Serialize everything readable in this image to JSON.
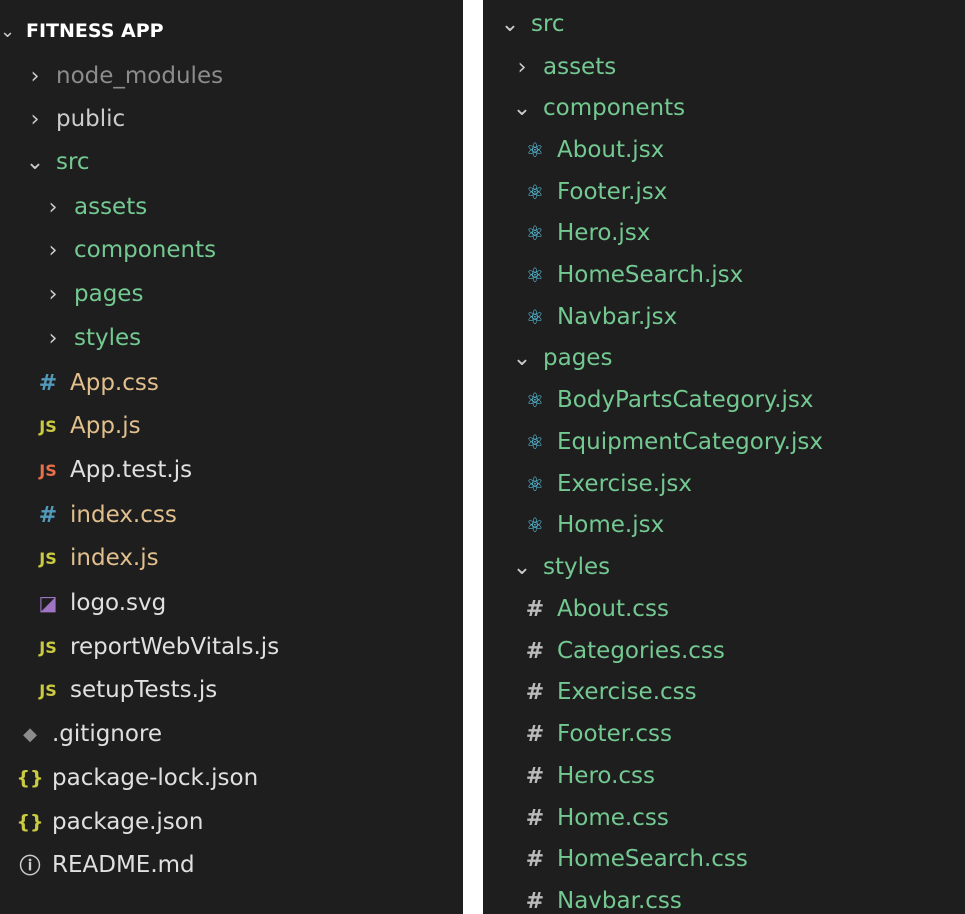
{
  "left": {
    "header": "FITNESS APP",
    "items": [
      {
        "label": "node_modules"
      },
      {
        "label": "public"
      },
      {
        "label": "src"
      },
      {
        "label": "assets"
      },
      {
        "label": "components"
      },
      {
        "label": "pages"
      },
      {
        "label": "styles"
      },
      {
        "label": "App.css"
      },
      {
        "label": "App.js"
      },
      {
        "label": "App.test.js"
      },
      {
        "label": "index.css"
      },
      {
        "label": "index.js"
      },
      {
        "label": "logo.svg"
      },
      {
        "label": "reportWebVitals.js"
      },
      {
        "label": "setupTests.js"
      },
      {
        "label": ".gitignore"
      },
      {
        "label": "package-lock.json"
      },
      {
        "label": "package.json"
      },
      {
        "label": "README.md"
      }
    ]
  },
  "right": {
    "items": [
      {
        "label": "src"
      },
      {
        "label": "assets"
      },
      {
        "label": "components"
      },
      {
        "label": "About.jsx"
      },
      {
        "label": "Footer.jsx"
      },
      {
        "label": "Hero.jsx"
      },
      {
        "label": "HomeSearch.jsx"
      },
      {
        "label": "Navbar.jsx"
      },
      {
        "label": "pages"
      },
      {
        "label": "BodyPartsCategory.jsx"
      },
      {
        "label": "EquipmentCategory.jsx"
      },
      {
        "label": "Exercise.jsx"
      },
      {
        "label": "Home.jsx"
      },
      {
        "label": "styles"
      },
      {
        "label": "About.css"
      },
      {
        "label": "Categories.css"
      },
      {
        "label": "Exercise.css"
      },
      {
        "label": "Footer.css"
      },
      {
        "label": "Hero.css"
      },
      {
        "label": "Home.css"
      },
      {
        "label": "HomeSearch.css"
      },
      {
        "label": "Navbar.css"
      }
    ]
  },
  "icons": {
    "chevron_right": "›",
    "chevron_down": "⌄",
    "js": "JS",
    "hash": "#",
    "react": "⚛",
    "svg": "◪",
    "git": "◆",
    "json": "{}",
    "info": "ⓘ"
  },
  "colors": {
    "background": "#1e1e1e",
    "untracked_green": "#73c991",
    "modified_yellow": "#e2c08d",
    "ignored_gray": "#8c8c8c",
    "js_yellow": "#cbcb41",
    "react_blue": "#61dafb",
    "css_blue": "#519aba"
  }
}
